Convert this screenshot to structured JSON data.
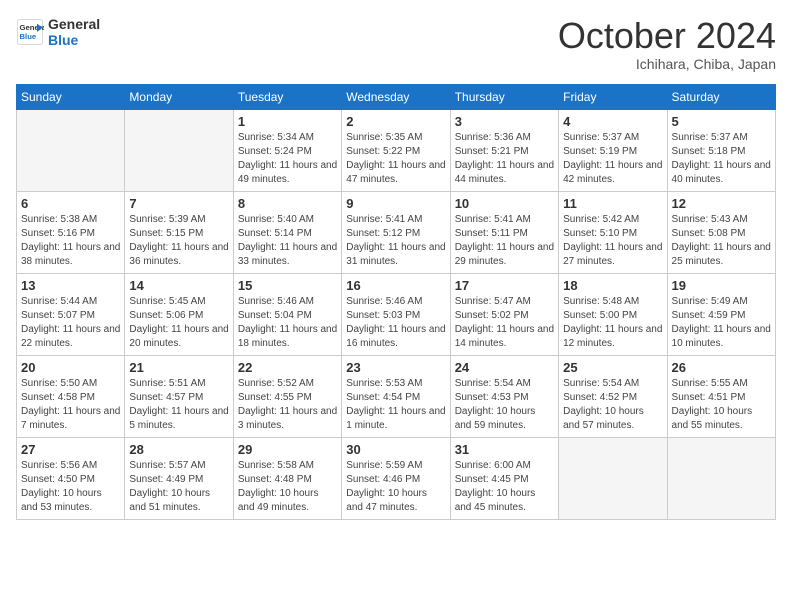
{
  "header": {
    "logo_line1": "General",
    "logo_line2": "Blue",
    "month_title": "October 2024",
    "location": "Ichihara, Chiba, Japan"
  },
  "weekdays": [
    "Sunday",
    "Monday",
    "Tuesday",
    "Wednesday",
    "Thursday",
    "Friday",
    "Saturday"
  ],
  "weeks": [
    [
      {
        "day": "",
        "info": ""
      },
      {
        "day": "",
        "info": ""
      },
      {
        "day": "1",
        "info": "Sunrise: 5:34 AM\nSunset: 5:24 PM\nDaylight: 11 hours and 49 minutes."
      },
      {
        "day": "2",
        "info": "Sunrise: 5:35 AM\nSunset: 5:22 PM\nDaylight: 11 hours and 47 minutes."
      },
      {
        "day": "3",
        "info": "Sunrise: 5:36 AM\nSunset: 5:21 PM\nDaylight: 11 hours and 44 minutes."
      },
      {
        "day": "4",
        "info": "Sunrise: 5:37 AM\nSunset: 5:19 PM\nDaylight: 11 hours and 42 minutes."
      },
      {
        "day": "5",
        "info": "Sunrise: 5:37 AM\nSunset: 5:18 PM\nDaylight: 11 hours and 40 minutes."
      }
    ],
    [
      {
        "day": "6",
        "info": "Sunrise: 5:38 AM\nSunset: 5:16 PM\nDaylight: 11 hours and 38 minutes."
      },
      {
        "day": "7",
        "info": "Sunrise: 5:39 AM\nSunset: 5:15 PM\nDaylight: 11 hours and 36 minutes."
      },
      {
        "day": "8",
        "info": "Sunrise: 5:40 AM\nSunset: 5:14 PM\nDaylight: 11 hours and 33 minutes."
      },
      {
        "day": "9",
        "info": "Sunrise: 5:41 AM\nSunset: 5:12 PM\nDaylight: 11 hours and 31 minutes."
      },
      {
        "day": "10",
        "info": "Sunrise: 5:41 AM\nSunset: 5:11 PM\nDaylight: 11 hours and 29 minutes."
      },
      {
        "day": "11",
        "info": "Sunrise: 5:42 AM\nSunset: 5:10 PM\nDaylight: 11 hours and 27 minutes."
      },
      {
        "day": "12",
        "info": "Sunrise: 5:43 AM\nSunset: 5:08 PM\nDaylight: 11 hours and 25 minutes."
      }
    ],
    [
      {
        "day": "13",
        "info": "Sunrise: 5:44 AM\nSunset: 5:07 PM\nDaylight: 11 hours and 22 minutes."
      },
      {
        "day": "14",
        "info": "Sunrise: 5:45 AM\nSunset: 5:06 PM\nDaylight: 11 hours and 20 minutes."
      },
      {
        "day": "15",
        "info": "Sunrise: 5:46 AM\nSunset: 5:04 PM\nDaylight: 11 hours and 18 minutes."
      },
      {
        "day": "16",
        "info": "Sunrise: 5:46 AM\nSunset: 5:03 PM\nDaylight: 11 hours and 16 minutes."
      },
      {
        "day": "17",
        "info": "Sunrise: 5:47 AM\nSunset: 5:02 PM\nDaylight: 11 hours and 14 minutes."
      },
      {
        "day": "18",
        "info": "Sunrise: 5:48 AM\nSunset: 5:00 PM\nDaylight: 11 hours and 12 minutes."
      },
      {
        "day": "19",
        "info": "Sunrise: 5:49 AM\nSunset: 4:59 PM\nDaylight: 11 hours and 10 minutes."
      }
    ],
    [
      {
        "day": "20",
        "info": "Sunrise: 5:50 AM\nSunset: 4:58 PM\nDaylight: 11 hours and 7 minutes."
      },
      {
        "day": "21",
        "info": "Sunrise: 5:51 AM\nSunset: 4:57 PM\nDaylight: 11 hours and 5 minutes."
      },
      {
        "day": "22",
        "info": "Sunrise: 5:52 AM\nSunset: 4:55 PM\nDaylight: 11 hours and 3 minutes."
      },
      {
        "day": "23",
        "info": "Sunrise: 5:53 AM\nSunset: 4:54 PM\nDaylight: 11 hours and 1 minute."
      },
      {
        "day": "24",
        "info": "Sunrise: 5:54 AM\nSunset: 4:53 PM\nDaylight: 10 hours and 59 minutes."
      },
      {
        "day": "25",
        "info": "Sunrise: 5:54 AM\nSunset: 4:52 PM\nDaylight: 10 hours and 57 minutes."
      },
      {
        "day": "26",
        "info": "Sunrise: 5:55 AM\nSunset: 4:51 PM\nDaylight: 10 hours and 55 minutes."
      }
    ],
    [
      {
        "day": "27",
        "info": "Sunrise: 5:56 AM\nSunset: 4:50 PM\nDaylight: 10 hours and 53 minutes."
      },
      {
        "day": "28",
        "info": "Sunrise: 5:57 AM\nSunset: 4:49 PM\nDaylight: 10 hours and 51 minutes."
      },
      {
        "day": "29",
        "info": "Sunrise: 5:58 AM\nSunset: 4:48 PM\nDaylight: 10 hours and 49 minutes."
      },
      {
        "day": "30",
        "info": "Sunrise: 5:59 AM\nSunset: 4:46 PM\nDaylight: 10 hours and 47 minutes."
      },
      {
        "day": "31",
        "info": "Sunrise: 6:00 AM\nSunset: 4:45 PM\nDaylight: 10 hours and 45 minutes."
      },
      {
        "day": "",
        "info": ""
      },
      {
        "day": "",
        "info": ""
      }
    ]
  ]
}
